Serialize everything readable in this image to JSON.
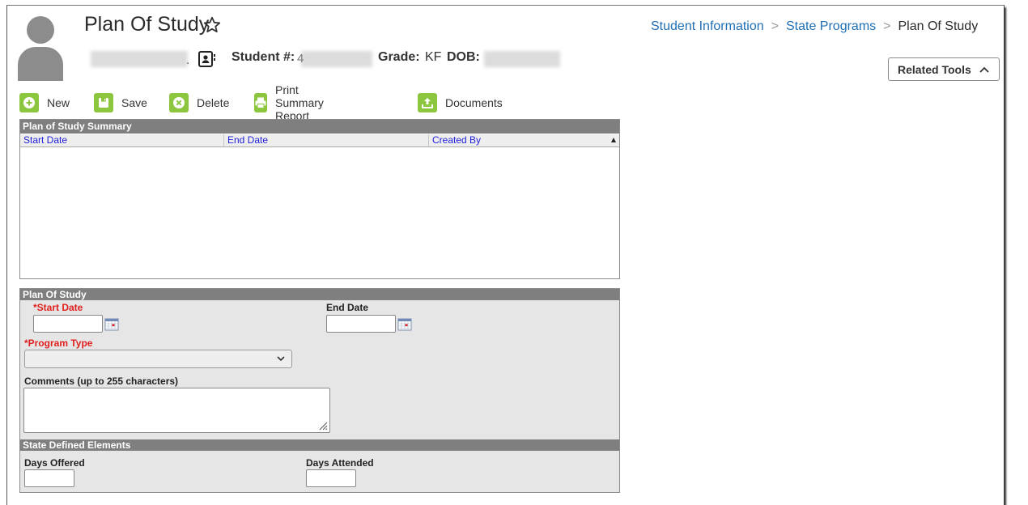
{
  "header": {
    "page_title": "Plan Of Study",
    "student_name_tail": ".",
    "student_number_label": "Student #:",
    "student_number_partial": "4",
    "grade_label": "Grade:",
    "grade_value": "KF",
    "dob_label": "DOB:"
  },
  "breadcrumb": {
    "items": [
      "Student Information",
      "State Programs",
      "Plan Of Study"
    ]
  },
  "related_tools": {
    "label": "Related Tools"
  },
  "toolbar": {
    "new_label": "New",
    "save_label": "Save",
    "delete_label": "Delete",
    "print_label": "Print Summary Report",
    "documents_label": "Documents"
  },
  "summary": {
    "title": "Plan of Study Summary",
    "columns": [
      "Start Date",
      "End Date",
      "Created By"
    ]
  },
  "form": {
    "title": "Plan Of Study",
    "start_date_label": "*Start Date",
    "end_date_label": "End Date",
    "program_type_label": "*Program Type",
    "comments_label": "Comments (up to 255 characters)",
    "start_date_value": "",
    "end_date_value": "",
    "comments_value": ""
  },
  "state_defined": {
    "title": "State Defined Elements",
    "days_offered_label": "Days Offered",
    "days_attended_label": "Days Attended",
    "days_offered_value": "",
    "days_attended_value": ""
  },
  "colors": {
    "accent_green": "#8cc63f",
    "panel_header": "#7f7f7f",
    "link_blue": "#1f6fb5",
    "required_red": "#e0201e",
    "column_header_blue": "#1f1fd8"
  }
}
